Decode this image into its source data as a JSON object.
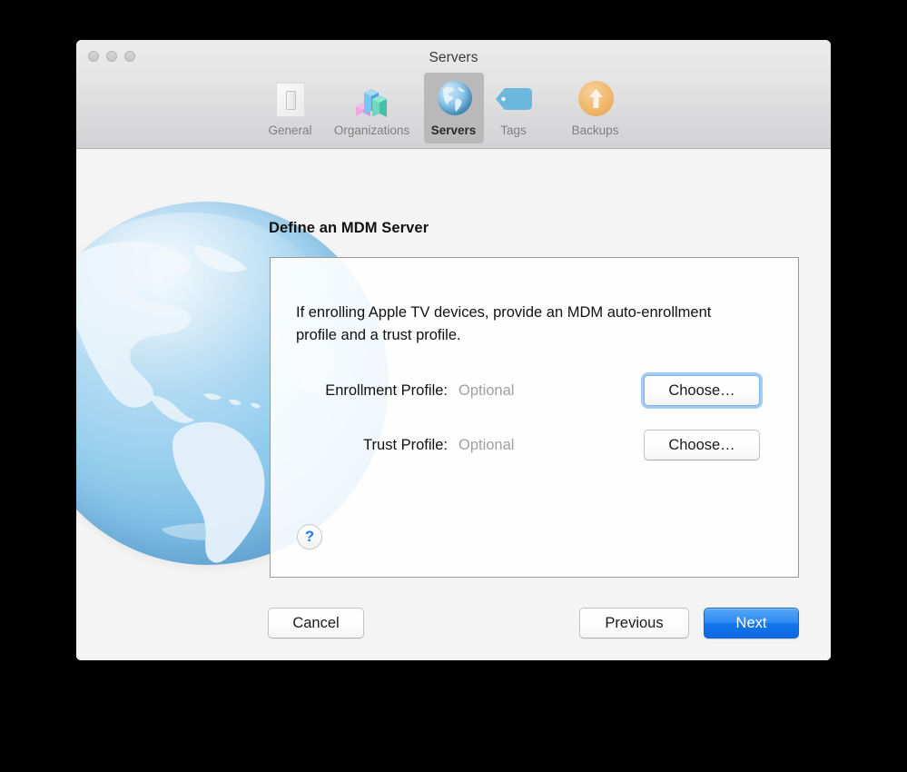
{
  "window": {
    "title": "Servers",
    "traffic_lights": [
      "close",
      "minimize",
      "zoom"
    ]
  },
  "toolbar": {
    "items": [
      {
        "label": "General",
        "icon": "light-switch-icon",
        "selected": false
      },
      {
        "label": "Organizations",
        "icon": "bar-chart-icon",
        "selected": false
      },
      {
        "label": "Servers",
        "icon": "globe-icon",
        "selected": true
      },
      {
        "label": "Tags",
        "icon": "tag-icon",
        "selected": false
      },
      {
        "label": "Backups",
        "icon": "upload-arrow-icon",
        "selected": false
      }
    ]
  },
  "sheet": {
    "heading": "Define an MDM Server",
    "description": "If enrolling Apple TV devices, provide an MDM auto-enrollment profile and a trust profile.",
    "fields": [
      {
        "label": "Enrollment Profile:",
        "value": "Optional",
        "button_label": "Choose…",
        "focused": true
      },
      {
        "label": "Trust Profile:",
        "value": "Optional",
        "button_label": "Choose…",
        "focused": false
      }
    ],
    "help_button": "?",
    "footer": {
      "cancel_label": "Cancel",
      "previous_label": "Previous",
      "next_label": "Next"
    }
  },
  "colors": {
    "accent_blue": "#1277ec",
    "focus_ring": "#58a0eb",
    "help_glyph": "#1d7cf2",
    "toolbar_selected_bg": "#b9b9b9",
    "globe_blue": "#7dbde6",
    "tag_blue": "#6bb8dc",
    "backup_orange": "#f0b86a",
    "placeholder_grey": "#a0a0a0",
    "window_bg": "#f4f4f4"
  },
  "decorations": {
    "globe_watermark": "globe-americas-watermark",
    "underlying_add_button": "add-button-partial"
  }
}
